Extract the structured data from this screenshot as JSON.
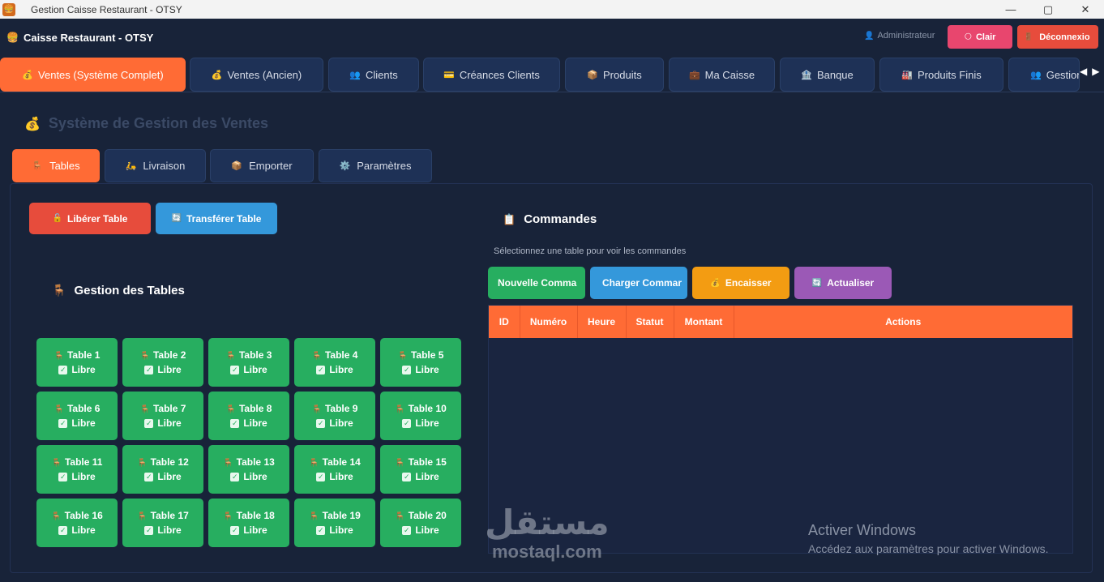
{
  "window": {
    "title": "Gestion Caisse Restaurant - OTSY",
    "app_icon": "restaurant-icon",
    "controls": {
      "minimize": "—",
      "maximize": "▢",
      "close": "✕"
    }
  },
  "header": {
    "brand_icon": "🍔",
    "brand": "Caisse Restaurant - OTSY",
    "user_icon": "👤",
    "user": "Administrateur",
    "theme_icon": "🌕",
    "theme_label": "Clair",
    "logout_icon": "🚪",
    "logout_label": "Déconnexio"
  },
  "main_tabs": [
    {
      "icon": "💰",
      "label": "Ventes (Système Complet)",
      "active": true
    },
    {
      "icon": "💰",
      "label": "Ventes (Ancien)",
      "active": false
    },
    {
      "icon": "👥",
      "label": "Clients",
      "active": false
    },
    {
      "icon": "💳",
      "label": "Créances Clients",
      "active": false
    },
    {
      "icon": "📦",
      "label": "Produits",
      "active": false
    },
    {
      "icon": "💼",
      "label": "Ma Caisse",
      "active": false
    },
    {
      "icon": "🏦",
      "label": "Banque",
      "active": false
    },
    {
      "icon": "🏭",
      "label": "Produits Finis",
      "active": false
    },
    {
      "icon": "👥",
      "label": "Gestion",
      "active": false
    }
  ],
  "tab_arrows": {
    "left": "◀",
    "right": "▶"
  },
  "section": {
    "icon": "💰",
    "title": "Système de Gestion des Ventes"
  },
  "sub_tabs": [
    {
      "icon": "🪑",
      "label": "Tables",
      "active": true
    },
    {
      "icon": "🛵",
      "label": "Livraison",
      "active": false
    },
    {
      "icon": "📦",
      "label": "Emporter",
      "active": false
    },
    {
      "icon": "⚙️",
      "label": "Paramètres",
      "active": false
    }
  ],
  "table_actions": {
    "liberer_icon": "🔓",
    "liberer": "Libérer Table",
    "transferer_icon": "🔄",
    "transferer": "Transférer Table"
  },
  "tables_section": {
    "icon": "🪑",
    "title": "Gestion des Tables"
  },
  "tables": [
    {
      "name": "Table 1",
      "status": "Libre"
    },
    {
      "name": "Table 2",
      "status": "Libre"
    },
    {
      "name": "Table 3",
      "status": "Libre"
    },
    {
      "name": "Table 4",
      "status": "Libre"
    },
    {
      "name": "Table 5",
      "status": "Libre"
    },
    {
      "name": "Table 6",
      "status": "Libre"
    },
    {
      "name": "Table 7",
      "status": "Libre"
    },
    {
      "name": "Table 8",
      "status": "Libre"
    },
    {
      "name": "Table 9",
      "status": "Libre"
    },
    {
      "name": "Table 10",
      "status": "Libre"
    },
    {
      "name": "Table 11",
      "status": "Libre"
    },
    {
      "name": "Table 12",
      "status": "Libre"
    },
    {
      "name": "Table 13",
      "status": "Libre"
    },
    {
      "name": "Table 14",
      "status": "Libre"
    },
    {
      "name": "Table 15",
      "status": "Libre"
    },
    {
      "name": "Table 16",
      "status": "Libre"
    },
    {
      "name": "Table 17",
      "status": "Libre"
    },
    {
      "name": "Table 18",
      "status": "Libre"
    },
    {
      "name": "Table 19",
      "status": "Libre"
    },
    {
      "name": "Table 20",
      "status": "Libre"
    }
  ],
  "table_card_icons": {
    "chair": "🪑",
    "check": "✓"
  },
  "orders": {
    "icon": "📋",
    "title": "Commandes",
    "hint": "Sélectionnez une table pour voir les commandes",
    "buttons": {
      "nouvelle": "Nouvelle Comma",
      "charger": "Charger Commar",
      "encaisser_icon": "💰",
      "encaisser": "Encaisser",
      "actualiser_icon": "🔄",
      "actualiser": "Actualiser"
    },
    "columns": [
      "ID",
      "Numéro",
      "Heure",
      "Statut",
      "Montant",
      "Actions"
    ],
    "rows": []
  },
  "watermark": {
    "activate_title": "Activer Windows",
    "activate_sub": "Accédez aux paramètres pour activer Windows.",
    "mostaql_ar": "مستقل",
    "mostaql_lat": "mostaql.com"
  },
  "colors": {
    "background": "#182339",
    "accent": "#ff6b35",
    "table_free": "#27ae60",
    "danger": "#e74c3c",
    "info": "#3498db",
    "warning": "#f39c12",
    "purple": "#9b59b6"
  }
}
